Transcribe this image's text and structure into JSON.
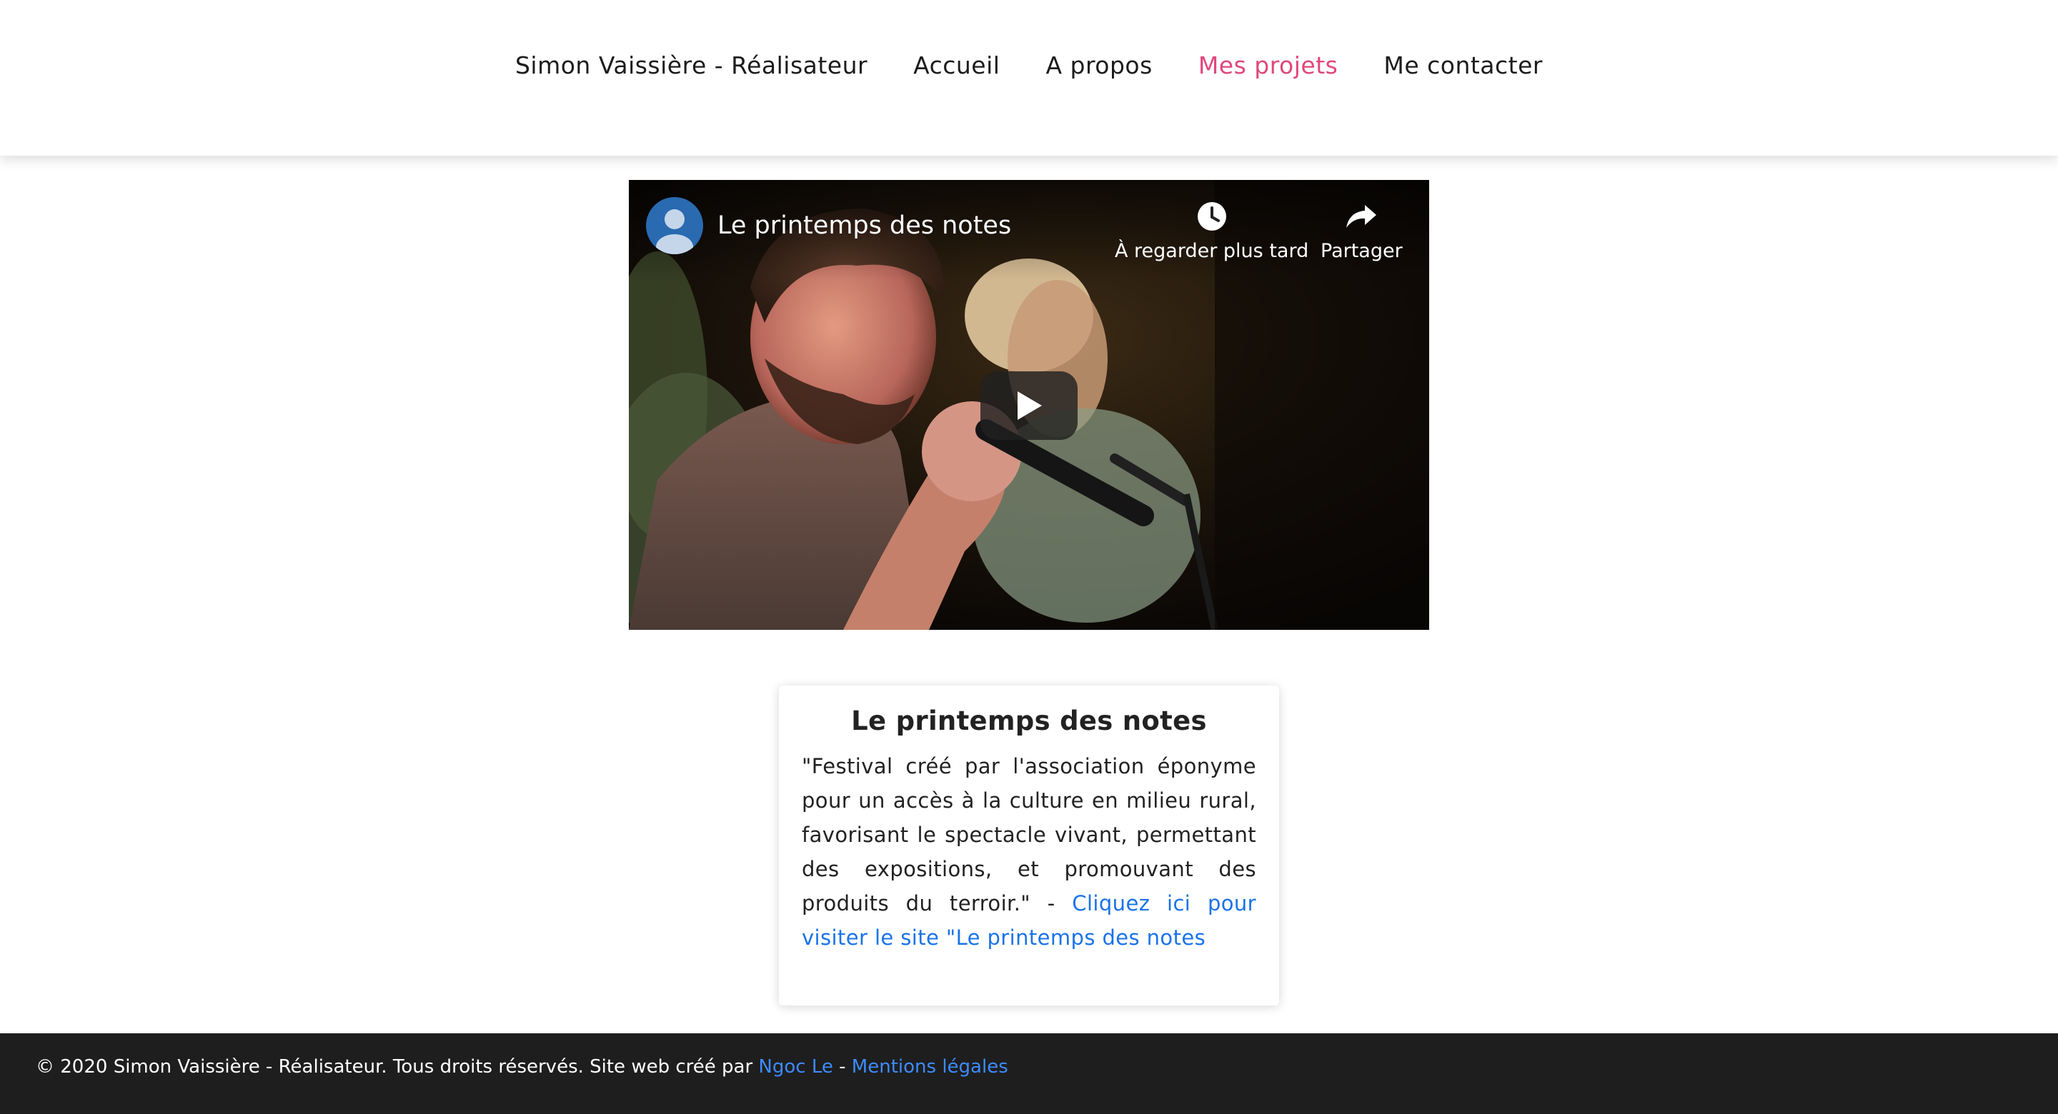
{
  "header": {
    "brand": "Simon Vaissière - Réalisateur",
    "nav": [
      {
        "label": "Accueil",
        "active": false
      },
      {
        "label": "A propos",
        "active": false
      },
      {
        "label": "Mes projets",
        "active": true
      },
      {
        "label": "Me contacter",
        "active": false
      }
    ],
    "active_color": "#e0477c"
  },
  "video": {
    "title": "Le printemps des notes",
    "watch_later_label": "À regarder plus tard",
    "share_label": "Partager",
    "icons": [
      "channel-avatar-icon",
      "clock-icon",
      "share-arrow-icon",
      "play-icon"
    ]
  },
  "card": {
    "title": "Le printemps des notes",
    "description": "\"Festival créé par l'association éponyme pour un accès à la culture en milieu rural, favorisant le spectacle vivant, permettant des expositions, et promouvant des produits du terroir.\" - ",
    "link_label": "Cliquez ici pour visiter le site \"Le printemps des notes"
  },
  "footer": {
    "copyright": "© 2020 Simon Vaissière - Réalisateur. Tous droits réservés. Site web créé par ",
    "author_link": "Ngoc Le",
    "separator": " - ",
    "legal_link": "Mentions légales",
    "link_color": "#3d8bfd"
  }
}
